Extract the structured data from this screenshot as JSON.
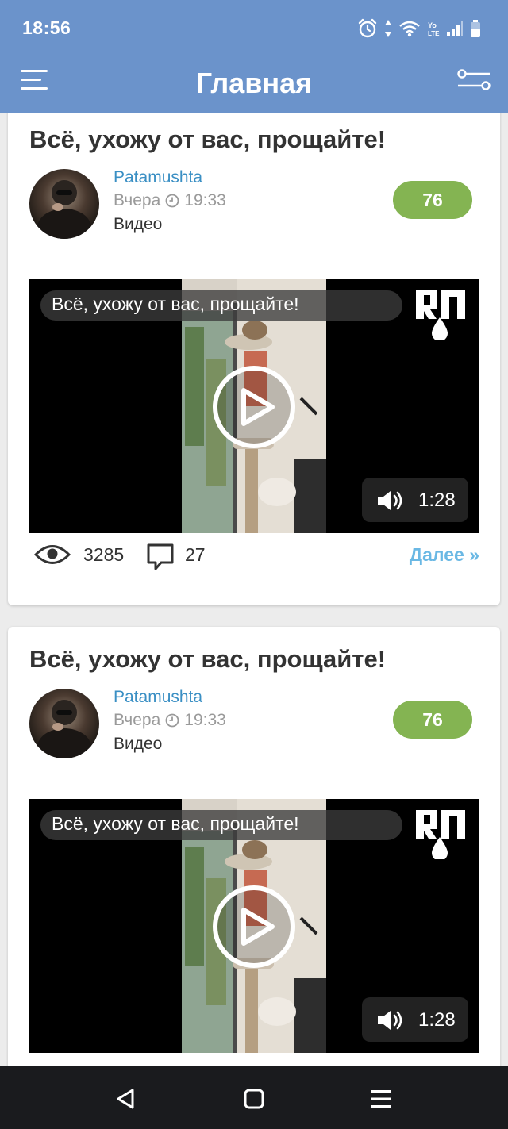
{
  "status_bar": {
    "time": "18:56",
    "icons": [
      "alarm-icon",
      "data-arrows-icon",
      "wifi-icon",
      "volte-icon",
      "signal-icon",
      "battery-icon"
    ]
  },
  "app_bar": {
    "title": "Главная",
    "left_icon": "menu-icon",
    "right_icon": "filter-icon",
    "color": "#6b93cb"
  },
  "posts": [
    {
      "title": "Всё, ухожу от вас, прощайте!",
      "author": "Patamushta",
      "date": "Вчера",
      "time": "19:33",
      "type": "Видео",
      "rating": "76",
      "video_title": "Всё, ухожу от вас, прощайте!",
      "duration": "1:28",
      "views": "3285",
      "comments": "27",
      "more_label": "Далее »"
    },
    {
      "title": "Всё, ухожу от вас, прощайте!",
      "author": "Patamushta",
      "date": "Вчера",
      "time": "19:33",
      "type": "Видео",
      "rating": "76",
      "video_title": "Всё, ухожу от вас, прощайте!",
      "duration": "1:28"
    }
  ],
  "colors": {
    "author_link": "#3a8fc4",
    "rating_badge": "#84b452",
    "more_link": "#6ab8e4"
  },
  "nav_bar": {
    "buttons": [
      "back-icon",
      "home-icon",
      "recents-icon"
    ]
  }
}
